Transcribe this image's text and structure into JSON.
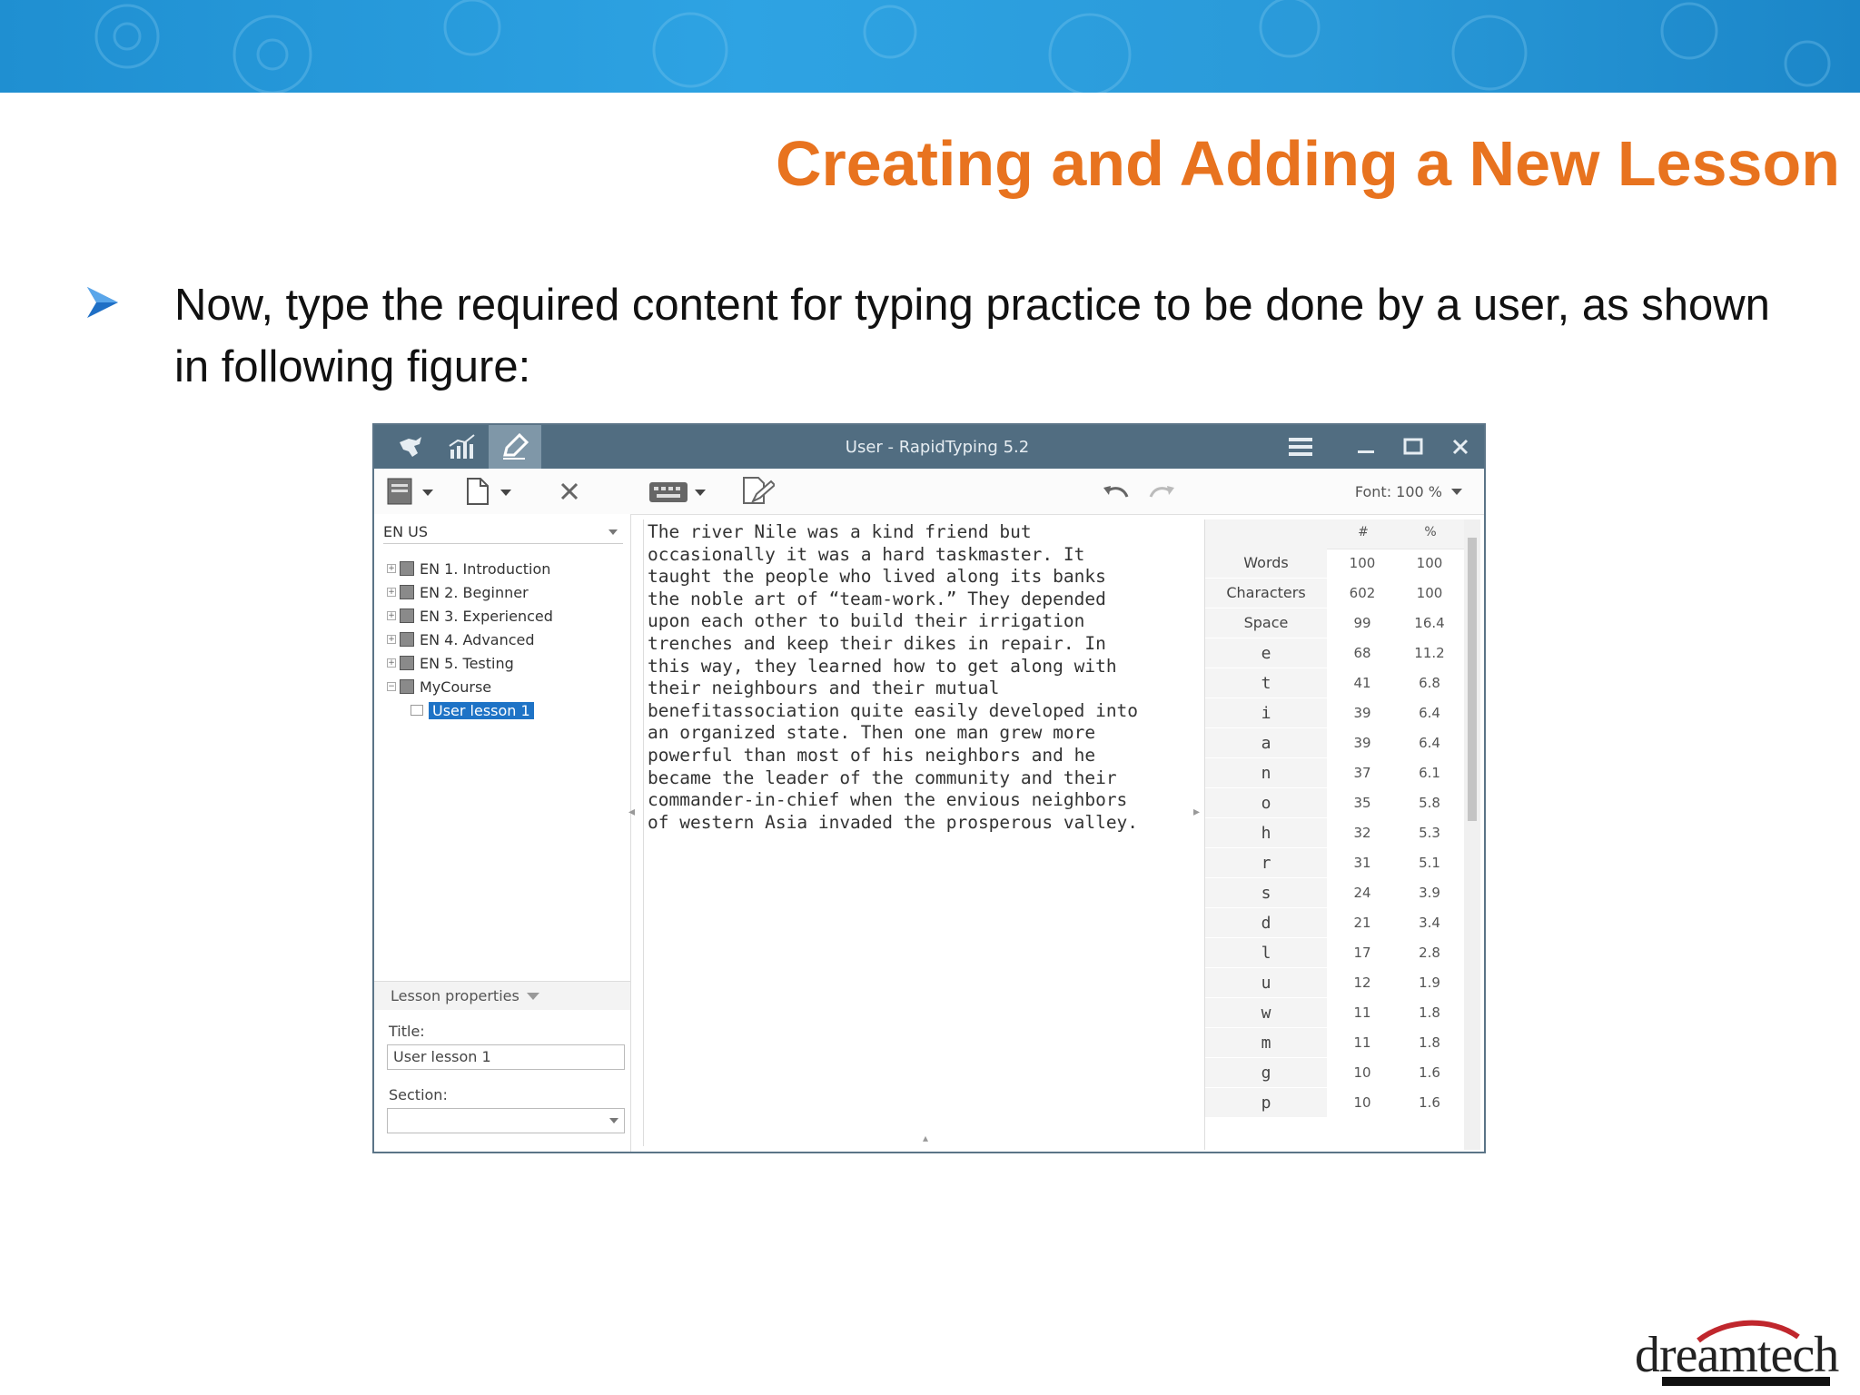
{
  "slide": {
    "title": "Creating and Adding a New Lesson",
    "bullet": "Now, type the required content for typing practice to be done by a user, as shown in following figure:",
    "logo_text": "dreamtech",
    "colors": {
      "banner": "#2a9ad9",
      "title": "#e8731f",
      "bullet_arrow": "#1f6fc5"
    }
  },
  "app": {
    "window_title": "User - RapidTyping 5.2",
    "toolbar": {
      "font_label": "Font: 100 %"
    },
    "language": "EN US",
    "tree": [
      {
        "label": "EN 1. Introduction"
      },
      {
        "label": "EN 2. Beginner"
      },
      {
        "label": "EN 3. Experienced"
      },
      {
        "label": "EN 4. Advanced"
      },
      {
        "label": "EN 5. Testing"
      },
      {
        "label": "MyCourse"
      }
    ],
    "selected_lesson": "User lesson 1",
    "lesson_properties": {
      "header": "Lesson properties",
      "title_label": "Title:",
      "title_value": "User lesson 1",
      "section_label": "Section:",
      "section_value": ""
    },
    "editor_text": "The river Nile was a kind friend but\noccasionally it was a hard taskmaster. It\ntaught the people who lived along its banks\nthe noble art of “team-work.” They depended\nupon each other to build their irrigation\ntrenches and keep their dikes in repair. In\nthis way, they learned how to get along with\ntheir neighbours and their mutual\nbenefitassociation quite easily developed into\nan organized state. Then one man grew more\npowerful than most of his neighbors and he\nbecame the leader of the community and their\ncommander-in-chief when the envious neighbors\nof western Asia invaded the prosperous valley.",
    "stats": {
      "col_count": "#",
      "col_pct": "%",
      "rows": [
        {
          "label": "Words",
          "count": "100",
          "pct": "100"
        },
        {
          "label": "Characters",
          "count": "602",
          "pct": "100"
        },
        {
          "label": "Space",
          "count": "99",
          "pct": "16.4"
        },
        {
          "label": "e",
          "count": "68",
          "pct": "11.2"
        },
        {
          "label": "t",
          "count": "41",
          "pct": "6.8"
        },
        {
          "label": "i",
          "count": "39",
          "pct": "6.4"
        },
        {
          "label": "a",
          "count": "39",
          "pct": "6.4"
        },
        {
          "label": "n",
          "count": "37",
          "pct": "6.1"
        },
        {
          "label": "o",
          "count": "35",
          "pct": "5.8"
        },
        {
          "label": "h",
          "count": "32",
          "pct": "5.3"
        },
        {
          "label": "r",
          "count": "31",
          "pct": "5.1"
        },
        {
          "label": "s",
          "count": "24",
          "pct": "3.9"
        },
        {
          "label": "d",
          "count": "21",
          "pct": "3.4"
        },
        {
          "label": "l",
          "count": "17",
          "pct": "2.8"
        },
        {
          "label": "u",
          "count": "12",
          "pct": "1.9"
        },
        {
          "label": "w",
          "count": "11",
          "pct": "1.8"
        },
        {
          "label": "m",
          "count": "11",
          "pct": "1.8"
        },
        {
          "label": "g",
          "count": "10",
          "pct": "1.6"
        },
        {
          "label": "p",
          "count": "10",
          "pct": "1.6"
        }
      ]
    }
  }
}
